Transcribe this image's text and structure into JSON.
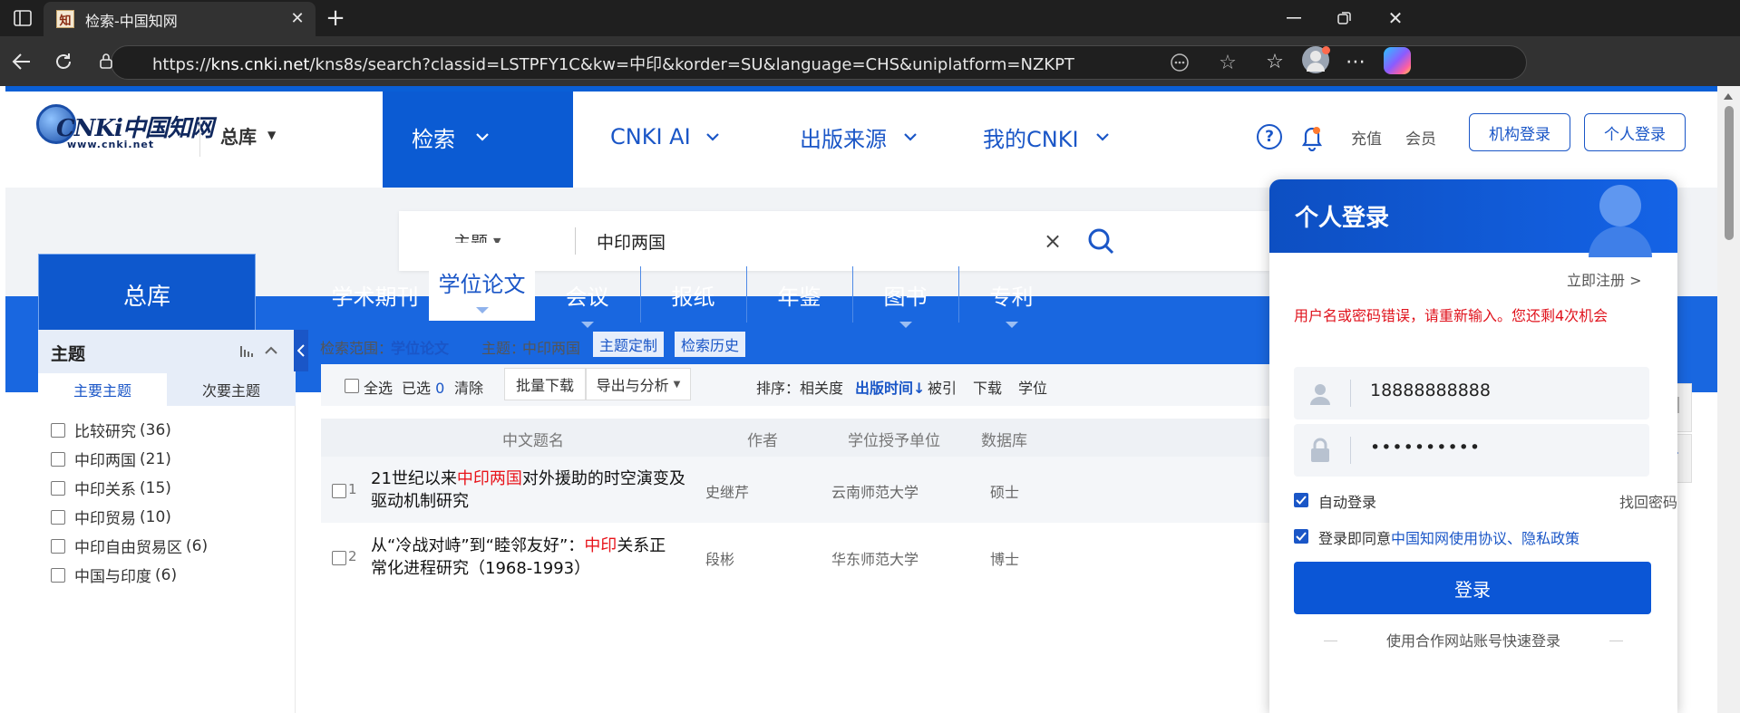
{
  "browser": {
    "tab_title": "检索-中国知网",
    "new_tab_symbol": "+",
    "url_prefix": "https://",
    "url_host": "kns.cnki.net",
    "url_rest": "/kns8s/search?classid=LSTPFY1C&kw=中印&korder=SU&language=CHS&uniplatform=NZKPT"
  },
  "header": {
    "logo_text": "CNKi中国知网",
    "logo_sub": "www.cnki.net",
    "library": "总库",
    "nav": [
      {
        "label": "检索"
      },
      {
        "label": "CNKI AI"
      },
      {
        "label": "出版来源"
      },
      {
        "label": "我的CNKI"
      }
    ],
    "recharge": "充值",
    "member": "会员",
    "institution_login": "机构登录",
    "personal_login": "个人登录"
  },
  "search": {
    "field": "主题",
    "query": "中印两国",
    "clear": "×"
  },
  "databases": {
    "all": "总库",
    "tabs": [
      {
        "label": "学术期刊"
      },
      {
        "label": "学位论文"
      },
      {
        "label": "会议"
      },
      {
        "label": "报纸"
      },
      {
        "label": "年鉴"
      },
      {
        "label": "图书"
      },
      {
        "label": "专利"
      }
    ]
  },
  "facets": {
    "title": "主题",
    "tab_main": "主要主题",
    "tab_secondary": "次要主题",
    "items": [
      {
        "label": "比较研究",
        "count": "(36)"
      },
      {
        "label": "中印两国",
        "count": "(21)"
      },
      {
        "label": "中印关系",
        "count": "(15)"
      },
      {
        "label": "中印贸易",
        "count": "(10)"
      },
      {
        "label": "中印自由贸易区",
        "count": "(6)"
      },
      {
        "label": "中国与印度",
        "count": "(6)"
      }
    ]
  },
  "results": {
    "scope_label": "检索范围：",
    "scope_value": "学位论文",
    "topic_label": "主题：",
    "topic_value": "中印两国",
    "customize": "主题定制",
    "history": "检索历史",
    "select_all": "全选",
    "selected_label": "已选",
    "selected_count": "0",
    "clear": "清除",
    "batch_download": "批量下载",
    "export": "导出与分析",
    "sort_label": "排序：",
    "sort_relevance": "相关度",
    "sort_date": "出版时间",
    "sort_cited": "被引",
    "sort_download": "下载",
    "sort_degree": "学位",
    "columns": [
      "中文题名",
      "作者",
      "学位授予单位",
      "数据库"
    ],
    "rows": [
      {
        "num": "1",
        "title_pre": "21世纪以来",
        "title_hl": "中印两国",
        "title_post": "对外援助的时空演变及",
        "title_line2": "驱动机制研究",
        "author": "史继芹",
        "unit": "云南师范大学",
        "db": "硕士"
      },
      {
        "num": "2",
        "title_pre": "从“冷战对峙”到“睦邻友好”：",
        "title_hl": "中印",
        "title_post": "关系正",
        "title_line2": "常化进程研究（1968-1993）",
        "author": "段彬",
        "unit": "华东师范大学",
        "db": "博士"
      }
    ]
  },
  "login": {
    "title": "个人登录",
    "register": "立即注册 >",
    "error": "用户名或密码错误，请重新输入。您还剩4次机会",
    "username": "18888888888",
    "password": "••••••••••",
    "auto_login": "自动登录",
    "forgot": "找回密码",
    "agree_prefix": "登录即同意",
    "agree_link1": "中国知网使用协议",
    "agree_sep": "、",
    "agree_link2": "隐私政策",
    "submit": "登录",
    "partner": "使用合作网站账号快速登录"
  },
  "colors": {
    "brand_blue": "#1967e0",
    "dark_blue": "#0b5bd3",
    "link_blue": "#1a56c7",
    "error_red": "#e0141e",
    "highlight_red": "#e8141b"
  }
}
